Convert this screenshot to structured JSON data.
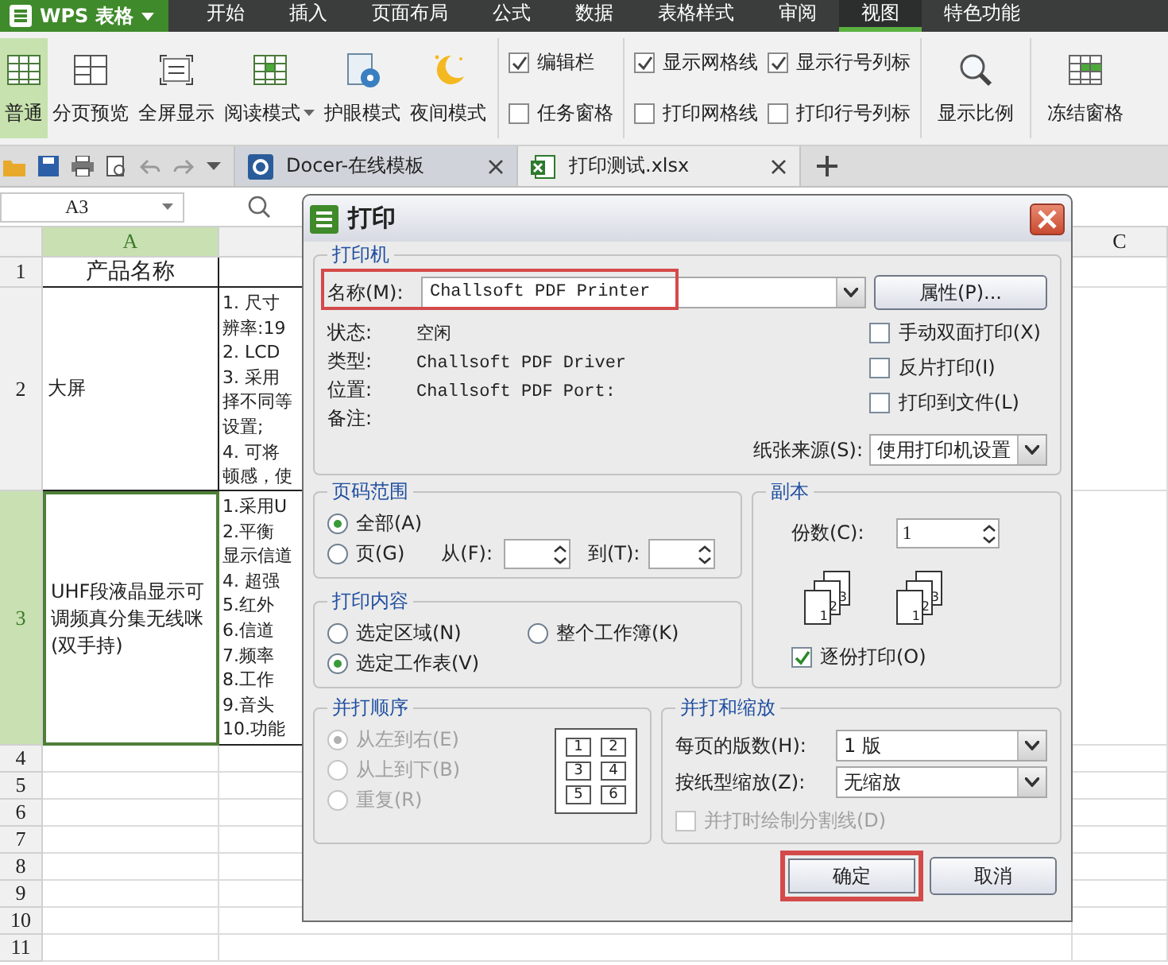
{
  "app_button": {
    "title": "WPS 表格"
  },
  "menu_tabs": [
    {
      "label": "开始",
      "selected": false
    },
    {
      "label": "插入",
      "selected": false
    },
    {
      "label": "页面布局",
      "selected": false
    },
    {
      "label": "公式",
      "selected": false
    },
    {
      "label": "数据",
      "selected": false
    },
    {
      "label": "表格样式",
      "selected": false
    },
    {
      "label": "审阅",
      "selected": false
    },
    {
      "label": "视图",
      "selected": true
    },
    {
      "label": "特色功能",
      "selected": false
    }
  ],
  "ribbon": {
    "view_buttons": [
      {
        "label": "普通",
        "kind": "normal",
        "selected": true,
        "dropdown": false
      },
      {
        "label": "分页预览",
        "kind": "page_break",
        "selected": false,
        "dropdown": false
      },
      {
        "label": "全屏显示",
        "kind": "fullscreen",
        "selected": false,
        "dropdown": false
      },
      {
        "label": "阅读模式",
        "kind": "reading",
        "selected": false,
        "dropdown": true
      },
      {
        "label": "护眼模式",
        "kind": "eye_care",
        "selected": false,
        "dropdown": false
      },
      {
        "label": "夜间模式",
        "kind": "night",
        "selected": false,
        "dropdown": false
      }
    ],
    "checkbox_groups": [
      [
        {
          "label": "编辑栏",
          "checked": true
        },
        {
          "label": "任务窗格",
          "checked": false
        }
      ],
      [
        {
          "label": "显示网格线",
          "checked": true
        },
        {
          "label": "打印网格线",
          "checked": false
        },
        {
          "label": "显示行号列标",
          "checked": true
        },
        {
          "label": "打印行号列标",
          "checked": false
        }
      ]
    ],
    "tool_buttons": [
      {
        "label": "显示比例",
        "kind": "zoom"
      },
      {
        "label": "冻结窗格",
        "kind": "freeze"
      }
    ]
  },
  "doc_tabs": [
    {
      "label": "Docer-在线模板",
      "kind": "docer",
      "selected": false
    },
    {
      "label": "打印测试.xlsx",
      "kind": "sheet",
      "selected": true
    }
  ],
  "name_box": {
    "value": "A3"
  },
  "sheet": {
    "columns": [
      {
        "label": "A",
        "selected": true
      },
      {
        "selected": false
      },
      {
        "label": "C",
        "selected": false
      }
    ],
    "rows": [
      {
        "number": "1",
        "selected": false,
        "a": "产品名称"
      },
      {
        "number": "2",
        "selected": false,
        "a": "大屏",
        "b_lines": [
          "1. 尺寸",
          "辨率:19",
          "2. LCD",
          "3. 采用",
          "择不同等",
          "设置;",
          "4. 可将",
          "顿感，使"
        ]
      },
      {
        "number": "3",
        "selected": true,
        "a": "UHF段液晶显示可调频真分集无线咪(双手持)",
        "b_lines": [
          "1.采用U",
          "2.平衡",
          "显示信道",
          "4. 超强",
          "5.红外",
          "6.信道",
          "7.频率",
          "8.工作",
          "9.音头",
          "10.功能"
        ]
      },
      {
        "number": "4",
        "selected": false
      },
      {
        "number": "5",
        "selected": false
      },
      {
        "number": "6",
        "selected": false
      },
      {
        "number": "7",
        "selected": false
      },
      {
        "number": "8",
        "selected": false
      },
      {
        "number": "9",
        "selected": false
      },
      {
        "number": "10",
        "selected": false
      },
      {
        "number": "11",
        "selected": false
      }
    ]
  },
  "print_dialog": {
    "title": "打印",
    "printer": {
      "legend": "打印机",
      "name_label": "名称(M):",
      "name_value": "Challsoft PDF Printer",
      "highlighted": true,
      "properties_button": "属性(P)...",
      "info": [
        {
          "label": "状态:",
          "value": "空闲"
        },
        {
          "label": "类型:",
          "value": "Challsoft PDF Driver"
        },
        {
          "label": "位置:",
          "value": "Challsoft PDF Port:"
        },
        {
          "label": "备注:"
        }
      ],
      "options": [
        {
          "label": "手动双面打印(X)",
          "checked": false
        },
        {
          "label": "反片打印(I)",
          "checked": false
        },
        {
          "label": "打印到文件(L)",
          "checked": false
        }
      ],
      "paper_source_label": "纸张来源(S):",
      "paper_source_value": "使用打印机设置"
    },
    "page_range": {
      "legend": "页码范围",
      "options": [
        {
          "label": "全部(A)",
          "selected": true
        },
        {
          "label": "页(G)",
          "selected": false
        }
      ],
      "from_label": "从(F):",
      "to_label": "到(T):"
    },
    "print_what": {
      "legend": "打印内容",
      "options": [
        {
          "label": "选定区域(N)",
          "selected": false
        },
        {
          "label": "整个工作簿(K)",
          "selected": false
        },
        {
          "label": "选定工作表(V)",
          "selected": true
        }
      ]
    },
    "copies": {
      "legend": "副本",
      "count_label": "份数(C):",
      "count_value": "1",
      "stacks": [
        [
          "1",
          "2",
          "3"
        ],
        [
          "1",
          "2",
          "3"
        ]
      ],
      "collate": {
        "label": "逐份打印(O)",
        "checked": true
      }
    },
    "order": {
      "legend": "并打顺序",
      "disabled": true,
      "options": [
        {
          "label": "从左到右(E)",
          "selected": true
        },
        {
          "label": "从上到下(B)",
          "selected": false
        },
        {
          "label": "重复(R)",
          "selected": false
        }
      ],
      "preview": [
        "1",
        "2",
        "3",
        "4",
        "5",
        "6"
      ]
    },
    "scaling": {
      "legend": "并打和缩放",
      "pages_label": "每页的版数(H):",
      "pages_value": "1 版",
      "scale_label": "按纸型缩放(Z):",
      "scale_value": "无缩放",
      "divider": {
        "label": "并打时绘制分割线(D)",
        "checked": false,
        "disabled": true
      }
    },
    "buttons": [
      {
        "label": "确定",
        "highlighted": true
      },
      {
        "label": "取消",
        "highlighted": false
      }
    ]
  }
}
